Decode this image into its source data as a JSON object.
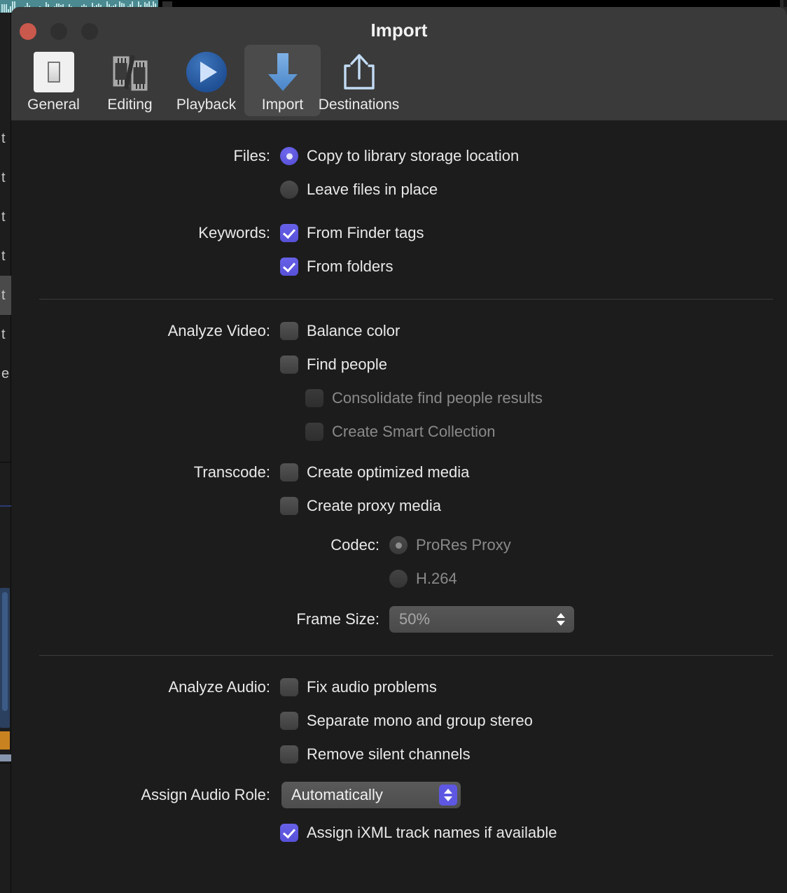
{
  "window": {
    "title": "Import",
    "traffic_lights": [
      "close",
      "minimize",
      "zoom"
    ]
  },
  "toolbar": {
    "items": [
      {
        "label": "General",
        "icon": "toggle-switch-icon",
        "selected": false
      },
      {
        "label": "Editing",
        "icon": "film-strips-icon",
        "selected": false
      },
      {
        "label": "Playback",
        "icon": "play-circle-icon",
        "selected": false
      },
      {
        "label": "Import",
        "icon": "download-arrow-icon",
        "selected": true
      },
      {
        "label": "Destinations",
        "icon": "share-export-icon",
        "selected": false
      }
    ]
  },
  "sections": {
    "files": {
      "label": "Files:",
      "options": [
        {
          "label": "Copy to library storage location",
          "selected": true
        },
        {
          "label": "Leave files in place",
          "selected": false
        }
      ]
    },
    "keywords": {
      "label": "Keywords:",
      "options": [
        {
          "label": "From Finder tags",
          "checked": true
        },
        {
          "label": "From folders",
          "checked": true
        }
      ]
    },
    "analyze_video": {
      "label": "Analyze Video:",
      "options": [
        {
          "label": "Balance color",
          "checked": false,
          "enabled": true
        },
        {
          "label": "Find people",
          "checked": false,
          "enabled": true
        },
        {
          "label": "Consolidate find people results",
          "checked": false,
          "enabled": false
        },
        {
          "label": "Create Smart Collection",
          "checked": false,
          "enabled": false
        }
      ]
    },
    "transcode": {
      "label": "Transcode:",
      "options": [
        {
          "label": "Create optimized media",
          "checked": false,
          "enabled": true
        },
        {
          "label": "Create proxy media",
          "checked": false,
          "enabled": true
        }
      ],
      "codec": {
        "label": "Codec:",
        "options": [
          {
            "label": "ProRes Proxy",
            "selected": true,
            "enabled": false
          },
          {
            "label": "H.264",
            "selected": false,
            "enabled": false
          }
        ]
      },
      "frame_size": {
        "label": "Frame Size:",
        "value": "50%",
        "enabled": false
      }
    },
    "analyze_audio": {
      "label": "Analyze Audio:",
      "options": [
        {
          "label": "Fix audio problems",
          "checked": false,
          "enabled": true
        },
        {
          "label": "Separate mono and group stereo",
          "checked": false,
          "enabled": true
        },
        {
          "label": "Remove silent channels",
          "checked": false,
          "enabled": true
        }
      ]
    },
    "assign_audio_role": {
      "label": "Assign Audio Role:",
      "value": "Automatically",
      "enabled": true,
      "extra_option": {
        "label": "Assign iXML track names if available",
        "checked": true
      }
    }
  },
  "colors": {
    "accent": "#5E57E2",
    "sheet_background": "#1C1C1C",
    "titlebar_background": "#3A3A3A",
    "close_button": "#C9584D",
    "import_arrow": "#5B9BD5",
    "destinations_icon": "#BFD9F2"
  }
}
